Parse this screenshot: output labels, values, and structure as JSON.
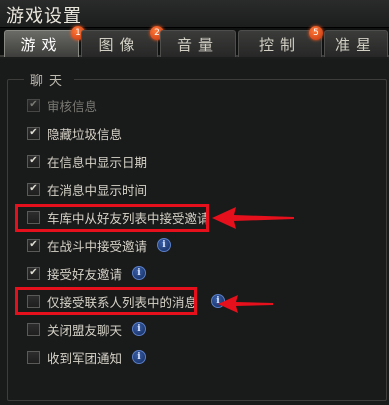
{
  "window": {
    "title": "游戏设置"
  },
  "tabs": [
    {
      "label": "游戏",
      "badge": "1",
      "active": true
    },
    {
      "label": "图像",
      "badge": "2",
      "active": false
    },
    {
      "label": "音量",
      "badge": "",
      "active": false
    },
    {
      "label": "控制",
      "badge": "5",
      "active": false
    },
    {
      "label": "准星",
      "badge": "",
      "active": false
    }
  ],
  "chat_group": {
    "title": "聊天",
    "options": [
      {
        "label": "审核信息",
        "checked": true,
        "disabled": true,
        "info": false
      },
      {
        "label": "隐藏垃圾信息",
        "checked": true,
        "disabled": false,
        "info": false
      },
      {
        "label": "在信息中显示日期",
        "checked": true,
        "disabled": false,
        "info": false
      },
      {
        "label": "在消息中显示时间",
        "checked": true,
        "disabled": false,
        "info": false
      },
      {
        "label": "车库中从好友列表中接受邀请",
        "checked": false,
        "disabled": false,
        "info": false
      },
      {
        "label": "在战斗中接受邀请",
        "checked": true,
        "disabled": false,
        "info": true
      },
      {
        "label": "接受好友邀请",
        "checked": true,
        "disabled": false,
        "info": true
      },
      {
        "label": "仅接受联系人列表中的消息",
        "checked": false,
        "disabled": false,
        "info": true
      },
      {
        "label": "关闭盟友聊天",
        "checked": false,
        "disabled": false,
        "info": true
      },
      {
        "label": "收到军团通知",
        "checked": false,
        "disabled": false,
        "info": true
      }
    ]
  },
  "colors": {
    "highlight": "#e5101b",
    "badge": "#e04a14",
    "info": "#2a4f9a"
  },
  "icons": {
    "check": "✔",
    "info": "i"
  }
}
